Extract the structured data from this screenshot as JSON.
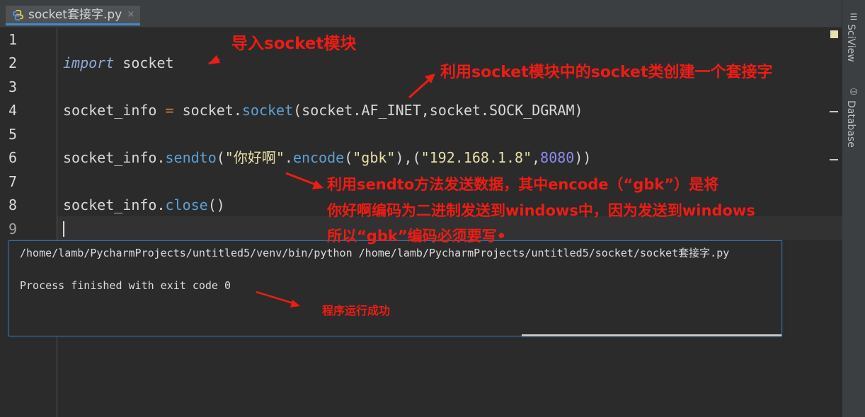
{
  "tab": {
    "label": "socket套接字.py",
    "close": "×"
  },
  "side_tabs": {
    "sciview": "SciView",
    "database": "Database"
  },
  "gutter": {
    "lines": [
      "1",
      "2",
      "3",
      "4",
      "5",
      "6",
      "7",
      "8",
      "9"
    ]
  },
  "code": {
    "line2": {
      "keyword": "import",
      "rest": " socket"
    },
    "line4": {
      "a": "socket_info ",
      "eq": "=",
      "b": " socket.",
      "fn": "socket",
      "c": "(socket.AF_INET,socket.SOCK_DGRAM)"
    },
    "line6": {
      "a": "socket_info.",
      "fn": "sendto",
      "b": "(",
      "s1": "\"你好啊\"",
      "c": ".",
      "fn2": "encode",
      "d": "(",
      "s2": "\"gbk\"",
      "e": "),(",
      "s3": "\"192.168.1.8\"",
      "f": ",",
      "n": "8080",
      "g": "))"
    },
    "line8": {
      "a": "socket_info.",
      "fn": "close",
      "b": "()"
    }
  },
  "console": {
    "command": "/home/lamb/PycharmProjects/untitled5/venv/bin/python /home/lamb/PycharmProjects/untitled5/socket/socket套接字.py",
    "exit": "Process finished with exit code 0"
  },
  "annotations": {
    "import_note": "导入socket模块",
    "socket_note": "利用socket模块中的socket类创建一个套接字",
    "sendto_note_1": "利用sendto方法发送数据，其中encode（“gbk”）是将",
    "sendto_note_2": "你好啊编码为二进制发送到windows中，因为发送到windows",
    "sendto_note_3": "所以“gbk”编码必须要写•",
    "success_note": "程序运行成功"
  },
  "colors": {
    "annotation": "#ee1c14",
    "background": "#2b2b2b",
    "tab_accent": "#4a88c7"
  }
}
